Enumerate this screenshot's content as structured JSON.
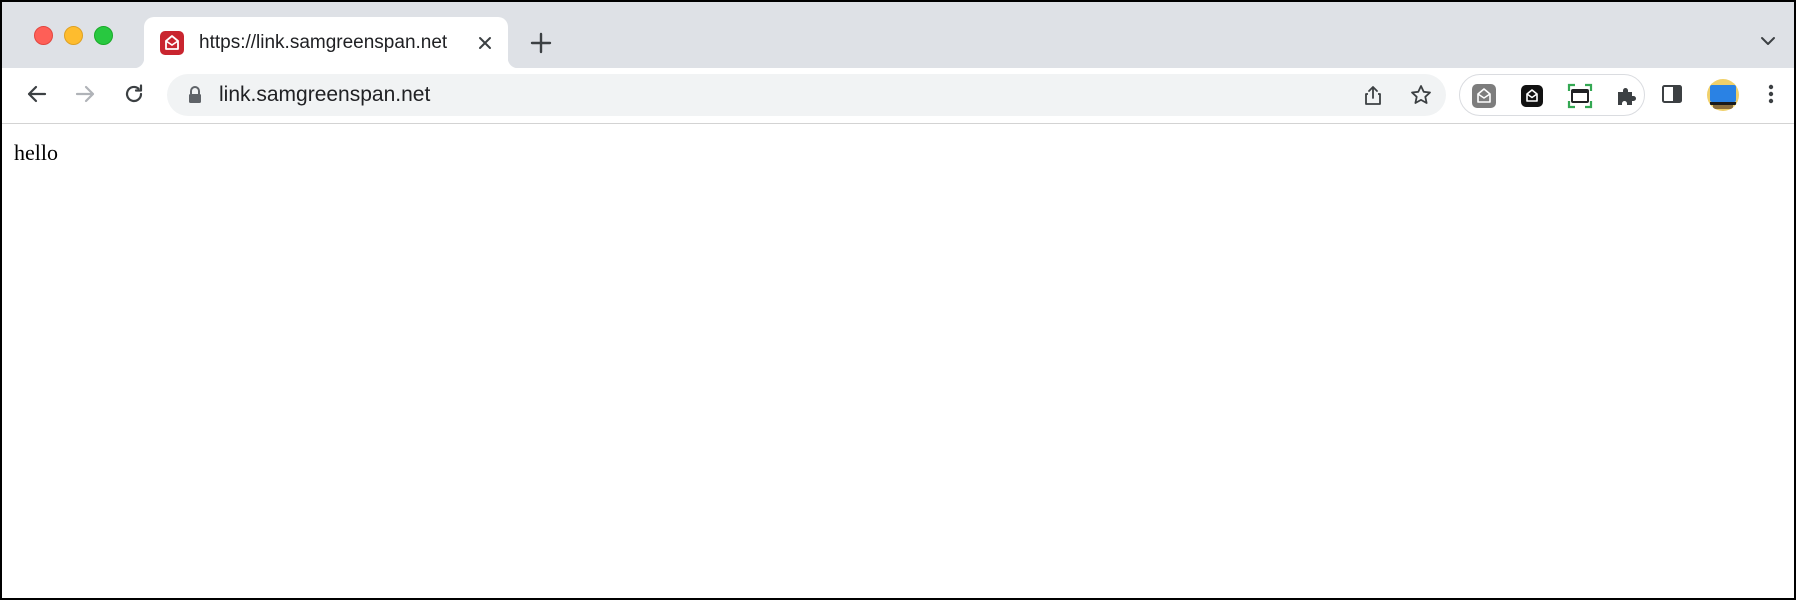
{
  "window": {
    "controls": [
      "close",
      "minimize",
      "zoom"
    ]
  },
  "tab": {
    "title": "https://link.samgreenspan.net",
    "favicon": "mail-envelope-icon"
  },
  "omnibox": {
    "url": "link.samgreenspan.net",
    "secure_icon": "lock-icon"
  },
  "colors": {
    "tabstrip": "#dee1e6",
    "favicon_bg": "#c9252f",
    "omnibox_bg": "#f1f3f4"
  },
  "page": {
    "text": "hello"
  }
}
